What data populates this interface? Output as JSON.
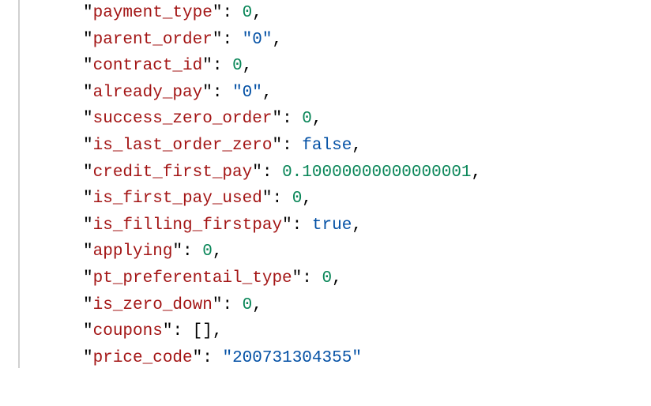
{
  "entries": [
    {
      "key": "payment_type",
      "type": "number",
      "display": "0"
    },
    {
      "key": "parent_order",
      "type": "string",
      "display": "0"
    },
    {
      "key": "contract_id",
      "type": "number",
      "display": "0"
    },
    {
      "key": "already_pay",
      "type": "string",
      "display": "0"
    },
    {
      "key": "success_zero_order",
      "type": "number",
      "display": "0"
    },
    {
      "key": "is_last_order_zero",
      "type": "bool",
      "display": "false"
    },
    {
      "key": "credit_first_pay",
      "type": "number",
      "display": "0.10000000000000001"
    },
    {
      "key": "is_first_pay_used",
      "type": "number",
      "display": "0"
    },
    {
      "key": "is_filling_firstpay",
      "type": "bool",
      "display": "true"
    },
    {
      "key": "applying",
      "type": "number",
      "display": "0"
    },
    {
      "key": "pt_preferentail_type",
      "type": "number",
      "display": "0"
    },
    {
      "key": "is_zero_down",
      "type": "number",
      "display": "0"
    },
    {
      "key": "coupons",
      "type": "array",
      "display": "[]"
    },
    {
      "key": "price_code",
      "type": "string",
      "display": "200731304355"
    }
  ]
}
